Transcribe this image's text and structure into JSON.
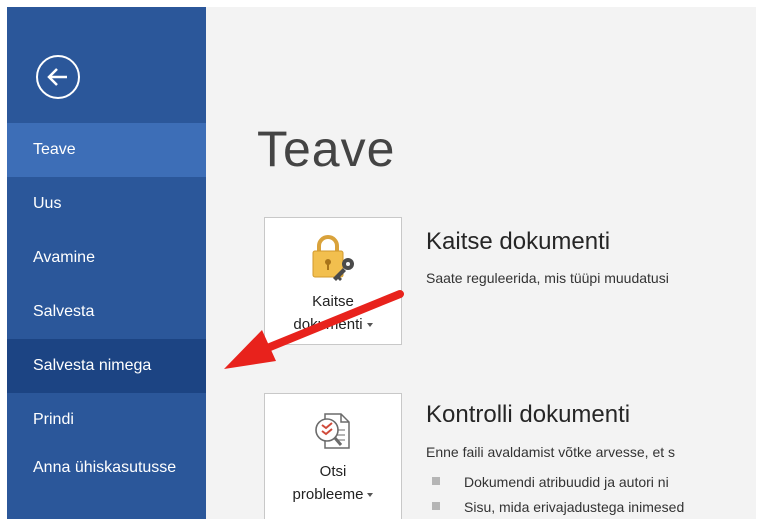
{
  "sidebar": {
    "items": [
      {
        "label": "Teave"
      },
      {
        "label": "Uus"
      },
      {
        "label": "Avamine"
      },
      {
        "label": "Salvesta"
      },
      {
        "label": "Salvesta nimega"
      },
      {
        "label": "Prindi"
      },
      {
        "label": "Anna ühiskasutusse"
      }
    ]
  },
  "main": {
    "title": "Teave",
    "protect": {
      "tile_line1": "Kaitse",
      "tile_line2": "dokumenti",
      "title": "Kaitse dokumenti",
      "desc": "Saate reguleerida, mis tüüpi muudatusi"
    },
    "inspect": {
      "tile_line1": "Otsi",
      "tile_line2": "probleeme",
      "title": "Kontrolli dokumenti",
      "desc": "Enne faili avaldamist võtke arvesse, et s",
      "bullets": [
        "Dokumendi atribuudid ja autori ni",
        "Sisu, mida erivajadustega inimesed"
      ]
    }
  },
  "colors": {
    "sidebar_bg": "#2b579a",
    "sidebar_active": "#3d6eb7",
    "sidebar_selected": "#1c4483",
    "annotation_arrow": "#e8221c"
  }
}
